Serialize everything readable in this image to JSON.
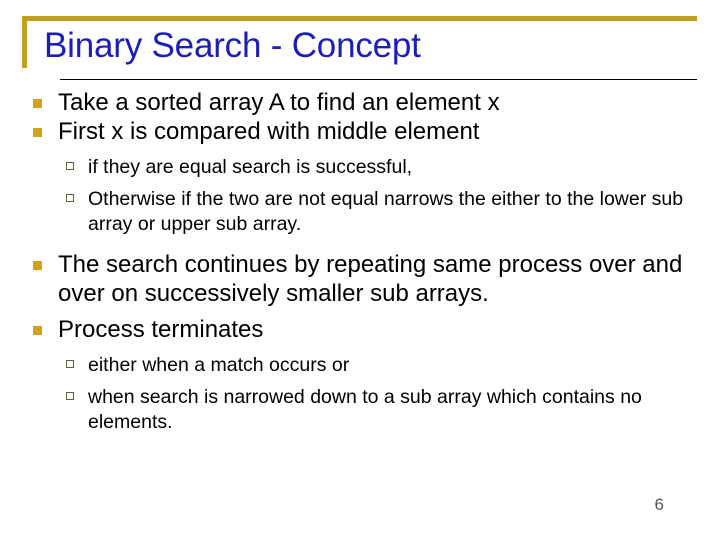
{
  "slide": {
    "title": "Binary Search - Concept",
    "number": "6",
    "accent_gold": "#BFA021",
    "bullet_l1_color": "#D4A017",
    "bullet_l2_color": "#57683F",
    "title_color": "#1D1DB8",
    "background": "#FFFFFF"
  },
  "content": {
    "b1": "Take a sorted array A to find an element x",
    "b2": "First  x is compared with middle element",
    "b2a": "if they are equal search is successful,",
    "b2b": "Otherwise if the two are not equal narrows the either to the lower sub array or upper sub array.",
    "b3": "The search continues by repeating same process over and over on successively smaller sub arrays.",
    "b4": "Process terminates",
    "b4a": "either when a match occurs or",
    "b4b": "when search is narrowed down to a sub array which contains no elements."
  }
}
